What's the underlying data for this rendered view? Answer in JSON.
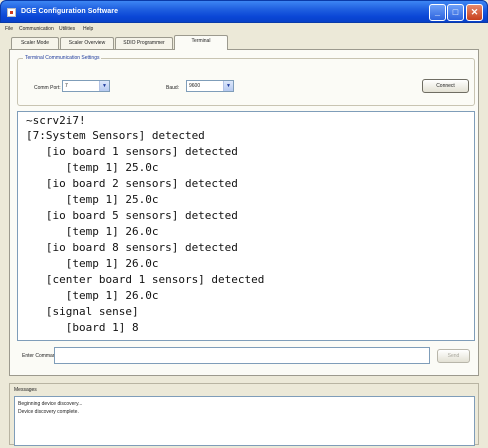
{
  "window": {
    "title": "DGE Configuration Software"
  },
  "title_buttons": {
    "minimize": "_",
    "maximize": "□",
    "close": "✕"
  },
  "menu": [
    "File",
    "Communication",
    "Utilities",
    "Help"
  ],
  "tabs": [
    {
      "label": "Scaler Mode"
    },
    {
      "label": "Scaler Overview"
    },
    {
      "label": "SDIO Programmer"
    },
    {
      "label": "Terminal",
      "active": true
    }
  ],
  "settings": {
    "legend": "Terminal Communication Settings",
    "com_port_label": "Comm Port:",
    "com_port_value": "7",
    "baud_label": "Baud:",
    "baud_value": "9600",
    "connect_label": "Connect"
  },
  "terminal_lines": [
    "~scrv2i7!",
    "[7:System Sensors] detected",
    "   [io board 1 sensors] detected",
    "      [temp 1] 25.0c",
    "   [io board 2 sensors] detected",
    "      [temp 1] 25.0c",
    "   [io board 5 sensors] detected",
    "      [temp 1] 26.0c",
    "   [io board 8 sensors] detected",
    "      [temp 1] 26.0c",
    "   [center board 1 sensors] detected",
    "      [temp 1] 26.0c",
    "   [signal sense]",
    "      [board 1] 8"
  ],
  "command": {
    "label": "Enter Command:",
    "value": "",
    "send_label": "Send"
  },
  "messages": {
    "title": "Messages",
    "lines": [
      "Beginning device discovery...",
      "Device discovery complete."
    ]
  },
  "colors": {
    "titlebar": "#0a46d6",
    "window_bg": "#ece9d8",
    "accent": "#1e3a9c"
  },
  "icons": {
    "app": "app-icon",
    "dropdown": "chevron-down-icon"
  }
}
